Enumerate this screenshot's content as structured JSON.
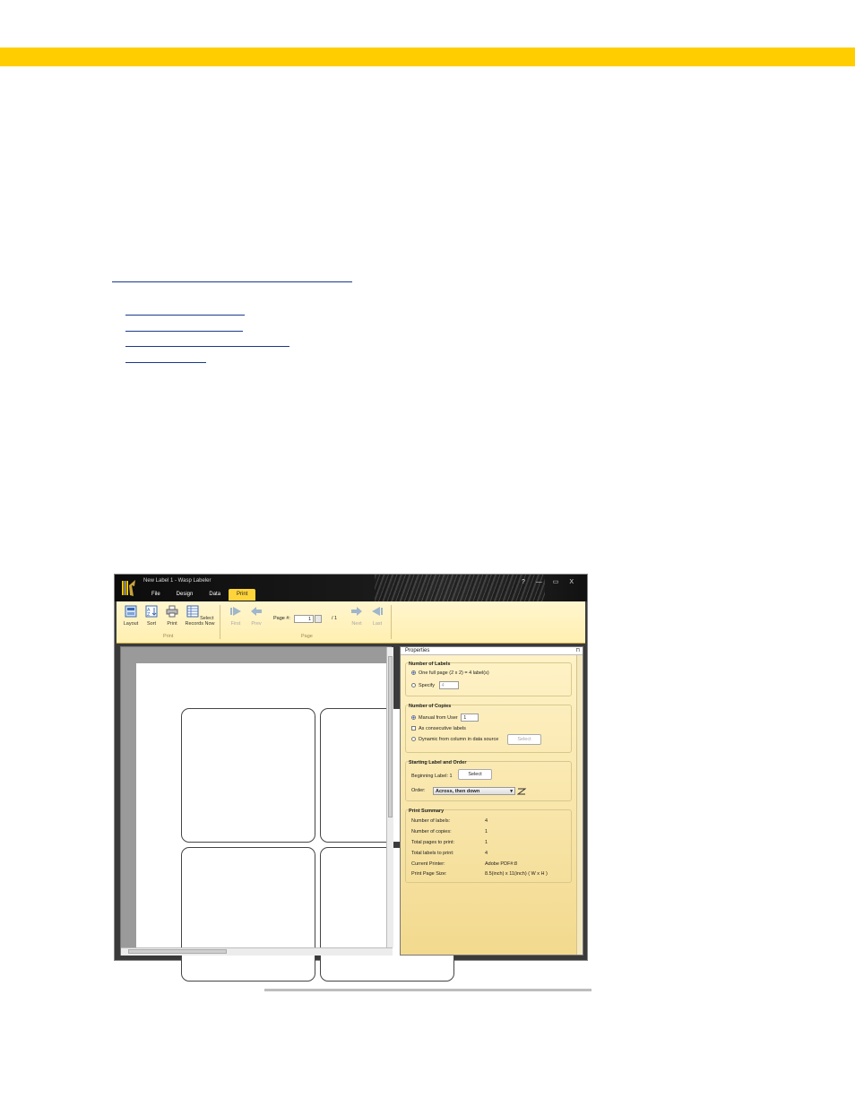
{
  "window": {
    "title": "New Label 1 - Wasp Labeler",
    "controls": "? — ▭ X",
    "tabs": [
      {
        "label": "File"
      },
      {
        "label": "Design"
      },
      {
        "label": "Data"
      },
      {
        "label": "Print",
        "active": true
      }
    ]
  },
  "ribbon": {
    "print_group": {
      "label": "Print",
      "buttons": [
        {
          "label": "Layout",
          "icon": "layout-icon"
        },
        {
          "label": "Sort",
          "icon": "sort-icon"
        },
        {
          "label": "Print",
          "icon": "printer-icon"
        },
        {
          "label": "Select Records Now",
          "icon": "records-icon"
        }
      ]
    },
    "page_group": {
      "label": "Page",
      "first": "First",
      "prev": "Prev",
      "next": "Next",
      "last": "Last",
      "page_label": "Page #:",
      "page_value": "1",
      "page_total": "/  1"
    }
  },
  "properties": {
    "header": "Properties",
    "number_of_labels": {
      "title": "Number of Labels",
      "option_full_page": "One full page (2 x 2) = 4 label(s)",
      "option_specify": "Specify",
      "specify_value": "4"
    },
    "number_of_copies": {
      "title": "Number of Copies",
      "manual": "Manual from User",
      "manual_value": "1",
      "consecutive": "As consecutive labels",
      "dynamic": "Dynamic from column in data source",
      "select_label": "Select"
    },
    "starting_label": {
      "title": "Starting Label and Order",
      "beginning": "Beginning Label: 1",
      "select_label": "Select",
      "order_label": "Order:",
      "order_value": "Across, then down"
    },
    "print_summary": {
      "title": "Print Summary",
      "rows": [
        {
          "key": "Number of labels:",
          "value": "4"
        },
        {
          "key": "Number of copies:",
          "value": "1"
        },
        {
          "key": "Total pages to print:",
          "value": "1"
        },
        {
          "key": "Total labels to print:",
          "value": "4"
        },
        {
          "key": "Current Printer:",
          "value": "Adobe PDF#:8"
        },
        {
          "key": "Print Page Size:",
          "value": "8.5(inch) x 11(inch) ( W x H )"
        }
      ]
    }
  }
}
